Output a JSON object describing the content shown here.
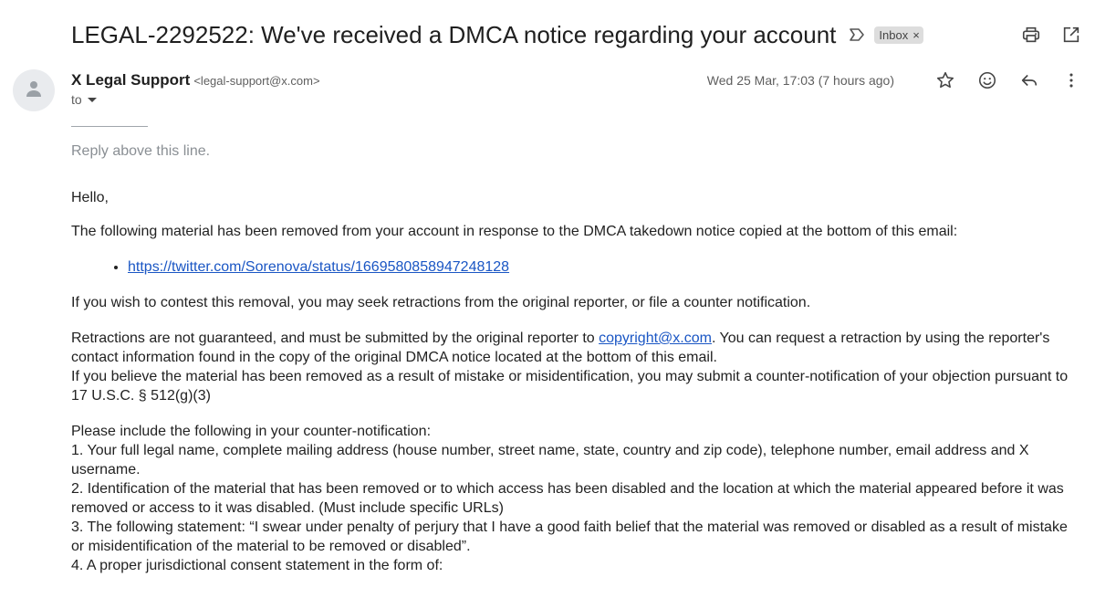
{
  "email": {
    "subject": "LEGAL-2292522: We've received a DMCA notice regarding your account",
    "label": "Inbox",
    "label_remove": "×",
    "sender_name": "X Legal Support",
    "sender_email": "<legal-support@x.com>",
    "to_label": "to",
    "date": "Wed 25 Mar, 17:03 (7 hours ago)"
  },
  "body": {
    "separator": "——————",
    "reply_above": "Reply above this line.",
    "greeting": "Hello,",
    "para1": "The following material has been removed from your account in response to the DMCA takedown notice copied at the bottom of this email:",
    "links": [
      "https://twitter.com/Sorenova/status/1669580858947248128"
    ],
    "para2": "If you wish to contest this removal, you may seek retractions from the original reporter, or file a counter notification.",
    "para3_before": "Retractions are not guaranteed, and must be submitted by the original reporter to ",
    "para3_link": "copyright@x.com",
    "para3_after": ". You can request a retraction by using the reporter's contact information found in the copy of the original DMCA notice located at the bottom of this email.",
    "para4": "If you believe the material has been removed as a result of mistake or misidentification, you may submit a counter-notification of your objection pursuant to 17 U.S.C. § 512(g)(3)",
    "para5_intro": "Please include the following in your counter-notification:",
    "items": [
      "1. Your full legal name, complete mailing address (house number, street name, state, country and zip code), telephone number, email address and X username.",
      "2. Identification of the material that has been removed or to which access has been disabled and the location at which the material appeared before it was removed or access to it was disabled. (Must include specific URLs)",
      "3. The following statement: “I swear under penalty of perjury that I have a good faith belief that the material was removed or disabled as a result of mistake or misidentification of the material to be removed or disabled”.",
      "4. A proper jurisdictional consent statement in the form of:"
    ]
  },
  "icons": {
    "important": "important-marker-icon",
    "print": "print-icon",
    "open_new_window": "open-in-new-window-icon",
    "avatar": "person-icon",
    "star": "star-icon",
    "emoji": "emoji-icon",
    "reply": "reply-icon",
    "more": "more-vertical-icon"
  },
  "colors": {
    "link": "#1a56c4",
    "chip_bg": "#dddddd",
    "muted": "#5e5e5e"
  }
}
